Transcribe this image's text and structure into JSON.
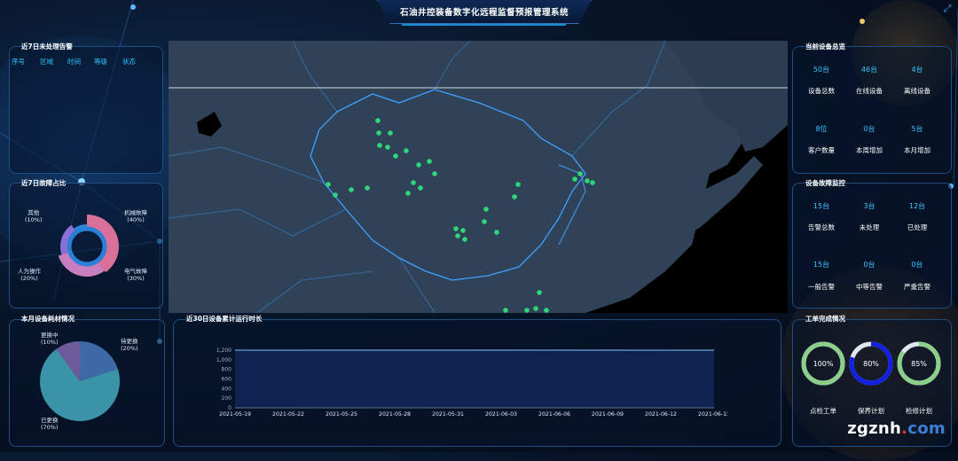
{
  "header": {
    "title": "石油井控装备数字化远程监督预报管理系统"
  },
  "alerts_panel": {
    "title": "近7日未处理告警",
    "columns": [
      "序号",
      "区域",
      "时间",
      "等级",
      "状态"
    ]
  },
  "fault_panel": {
    "title": "近7日故障占比",
    "segments": [
      {
        "label": "机械故障",
        "pct": "(40%)",
        "value": 40,
        "color": "#d9709a"
      },
      {
        "label": "电气故障",
        "pct": "(30%)",
        "value": 30,
        "color": "#c77fbf"
      },
      {
        "label": "人为操作",
        "pct": "(20%)",
        "value": 20,
        "color": "#8a6fd6"
      },
      {
        "label": "其他",
        "pct": "(10%)",
        "value": 10,
        "color": "#2a8be0"
      }
    ]
  },
  "material_panel": {
    "title": "本月设备耗材情况",
    "slices": [
      {
        "label": "待更换",
        "pct": "(20%)",
        "value": 20,
        "color": "#3d6aa7"
      },
      {
        "label": "已更换",
        "pct": "(70%)",
        "value": 70,
        "color": "#3a93a6"
      },
      {
        "label": "更换中",
        "pct": "(10%)",
        "value": 10,
        "color": "#6c5a9a"
      }
    ]
  },
  "overview_panel": {
    "title": "当前设备总览",
    "stats": [
      {
        "value": "50台",
        "label": "设备总数"
      },
      {
        "value": "46台",
        "label": "在线设备"
      },
      {
        "value": "4台",
        "label": "离线设备"
      },
      {
        "value": "8位",
        "label": "客户数量"
      },
      {
        "value": "0台",
        "label": "本周增加"
      },
      {
        "value": "5台",
        "label": "本月增加"
      }
    ]
  },
  "monitor_panel": {
    "title": "设备故障监控",
    "stats": [
      {
        "value": "15台",
        "label": "告警总数"
      },
      {
        "value": "3台",
        "label": "未处理"
      },
      {
        "value": "12台",
        "label": "已处理"
      },
      {
        "value": "15台",
        "label": "一般告警"
      },
      {
        "value": "0台",
        "label": "中等告警"
      },
      {
        "value": "0台",
        "label": "严重告警"
      }
    ]
  },
  "workorder_panel": {
    "title": "工单完成情况",
    "gauges": [
      {
        "value": "100%",
        "fraction": 1.0,
        "label": "点检工单",
        "color": "#8ccf8a"
      },
      {
        "value": "80%",
        "fraction": 0.8,
        "label": "保养计划",
        "color": "#1220e0"
      },
      {
        "value": "85%",
        "fraction": 0.85,
        "label": "检修计划",
        "color": "#8ccf8a"
      }
    ]
  },
  "runtime_panel": {
    "title": "近30日设备累计运行时长"
  },
  "chart_data": {
    "type": "area",
    "title": "近30日设备累计运行时长",
    "xlabel": "",
    "ylabel": "",
    "x": [
      "2021-05-19",
      "2021-05-22",
      "2021-05-25",
      "2021-05-28",
      "2021-05-31",
      "2021-06-03",
      "2021-06-06",
      "2021-06-09",
      "2021-06-12",
      "2021-06-15"
    ],
    "values": [
      1200,
      1200,
      1200,
      1200,
      1200,
      1200,
      1200,
      1200,
      1200,
      1200
    ],
    "yticks": [
      "0",
      "200",
      "400",
      "600",
      "800",
      "1,000",
      "1,200"
    ],
    "ylim": [
      0,
      1200
    ],
    "grid": false,
    "colors": {
      "line": "#6ea0d6",
      "fill": "#112556"
    }
  },
  "map": {
    "dot_color": "#2fd67a",
    "sites": [
      [
        426,
        136
      ],
      [
        440,
        150
      ],
      [
        427,
        150
      ],
      [
        437,
        166
      ],
      [
        458,
        170
      ],
      [
        446,
        176
      ],
      [
        428,
        164
      ],
      [
        472,
        186
      ],
      [
        484,
        182
      ],
      [
        490,
        196
      ],
      [
        466,
        206
      ],
      [
        460,
        218
      ],
      [
        474,
        212
      ],
      [
        414,
        212
      ],
      [
        396,
        214
      ],
      [
        378,
        220
      ],
      [
        370,
        208
      ],
      [
        584,
        208
      ],
      [
        580,
        222
      ],
      [
        548,
        236
      ],
      [
        546,
        250
      ],
      [
        560,
        262
      ],
      [
        522,
        260
      ],
      [
        514,
        258
      ],
      [
        516,
        266
      ],
      [
        524,
        270
      ],
      [
        654,
        196
      ],
      [
        662,
        204
      ],
      [
        648,
        202
      ],
      [
        668,
        206
      ],
      [
        608,
        330
      ],
      [
        604,
        348
      ],
      [
        594,
        350
      ],
      [
        616,
        350
      ],
      [
        570,
        350
      ]
    ]
  },
  "watermark": {
    "a": "zgznh",
    "b": ".",
    "c": "com"
  }
}
